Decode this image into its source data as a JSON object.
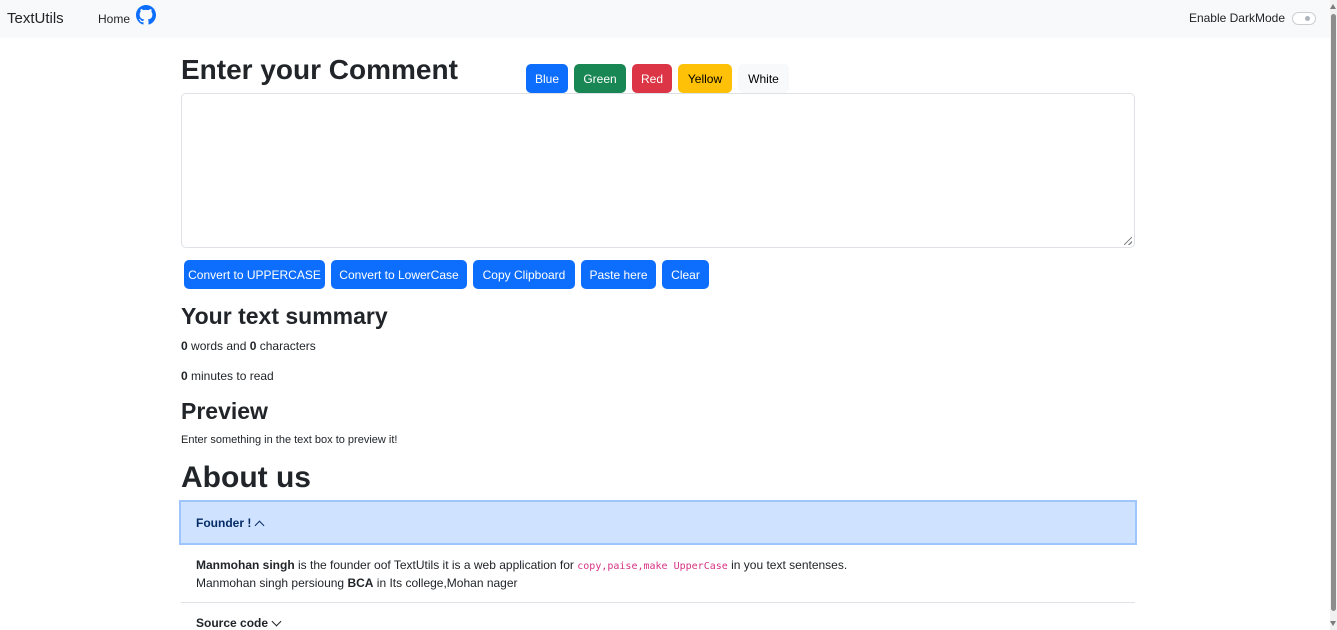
{
  "navbar": {
    "brand": "TextUtils",
    "home": "Home",
    "github_icon": "github-icon",
    "dark_mode_label": "Enable DarkMode"
  },
  "editor": {
    "heading": "Enter your Comment",
    "color_buttons": [
      "Blue",
      "Green",
      "Red",
      "Yellow",
      "White"
    ],
    "textarea_value": "",
    "actions": [
      "Convert to UPPERCASE",
      "Convert to LowerCase",
      "Copy Clipboard",
      "Paste here",
      "Clear"
    ]
  },
  "summary": {
    "heading": "Your text summary",
    "words": "0",
    "words_text": " words and ",
    "characters": "0",
    "characters_text": " characters",
    "minutes": "0",
    "minutes_text": " minutes to read"
  },
  "preview": {
    "heading": "Preview",
    "text": "Enter something in the text box to preview it!"
  },
  "about": {
    "heading": "About us",
    "accordion": [
      {
        "title": "Founder !",
        "expanded": true,
        "body": {
          "name": "Manmohan singh",
          "text1": " is the founder oof TextUtils it is a web application for ",
          "code": "copy,paise,make UpperCase",
          "text2": " in you text sentenses.",
          "line2_a": "Manmohan singh persioung ",
          "line2_bold": "BCA",
          "line2_b": " in Its college,Mohan nager"
        }
      },
      {
        "title": "Source code",
        "expanded": false
      }
    ]
  },
  "colors": {
    "blue": "#0d6efd",
    "green": "#198754",
    "red": "#dc3545",
    "yellow": "#ffc107",
    "accordion_active": "#cfe2ff"
  }
}
